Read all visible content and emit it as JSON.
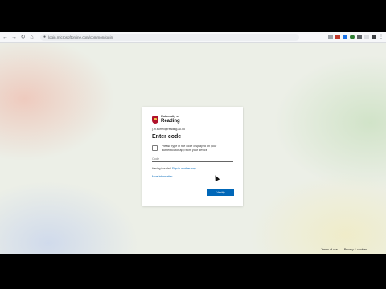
{
  "browser": {
    "url": "login.microsoftonline.com/common/login",
    "icons": [
      "back-icon",
      "forward-icon",
      "reload-icon",
      "home-icon",
      "lock-icon"
    ]
  },
  "card": {
    "logo_small": "University of",
    "logo_big": "Reading",
    "user": "j.m.burrell@reading.ac.uk",
    "title": "Enter code",
    "instructions": "Please type in the code displayed on your authenticator app from your device",
    "code_placeholder": "Code",
    "trouble_prefix": "Having trouble?",
    "trouble_link": "Sign in another way",
    "more_info": "More information",
    "verify_label": "Verify"
  },
  "footer": {
    "terms": "Terms of use",
    "privacy": "Privacy & cookies",
    "more": "..."
  },
  "colors": {
    "accent": "#0067b8",
    "crest": "#b0122b"
  }
}
